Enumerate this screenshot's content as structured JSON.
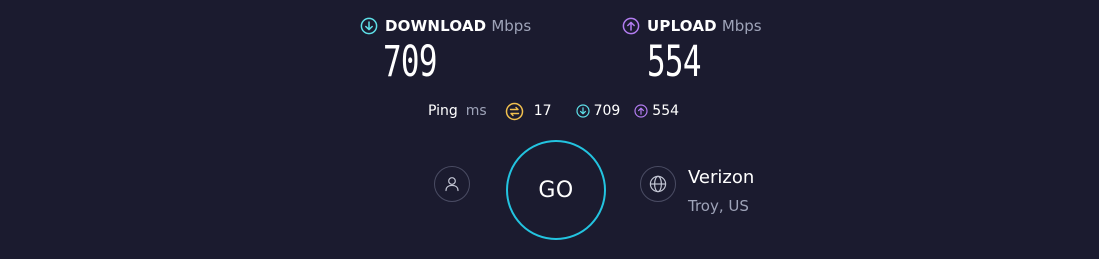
{
  "download": {
    "label": "DOWNLOAD",
    "unit": "Mbps",
    "value": "709",
    "icon": "download-arrow-icon",
    "color": "#5ee0e8"
  },
  "upload": {
    "label": "UPLOAD",
    "unit": "Mbps",
    "value": "554",
    "icon": "upload-arrow-icon",
    "color": "#b27cf0"
  },
  "ping": {
    "label": "Ping",
    "unit": "ms",
    "icon": "ping-idle-icon",
    "icon_color": "#f2c14e",
    "value": "17",
    "download_value": "709",
    "upload_value": "554"
  },
  "go_button": {
    "label": "GO",
    "ring_color": "#23c4e0"
  },
  "server": {
    "name": "Verizon",
    "location": "Troy, US"
  },
  "icons": {
    "user": "user-icon",
    "globe": "globe-icon"
  }
}
